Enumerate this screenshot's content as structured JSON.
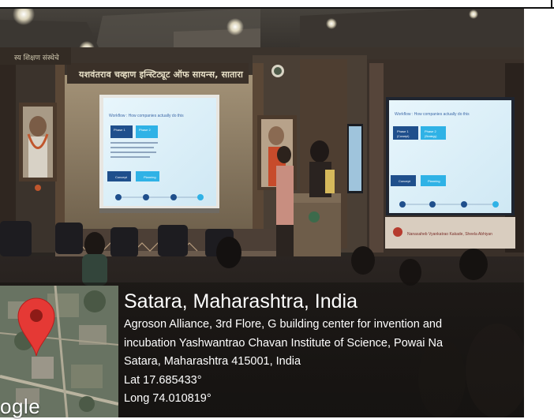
{
  "scene": {
    "banner_main": "यशवंतराव चव्हाण इन्स्टिट्यूट ऑफ सायन्स, सातारा",
    "banner_side": "स्य शिक्षण संस्थेचे",
    "slide": {
      "heading": "Workflow : How companies actually do this",
      "phase1": "Phase 1",
      "phase1_sub": "(Concept)",
      "phase2": "Phase 2",
      "phase2_sub": "(Strategy)",
      "step_concept": "Concept",
      "step_planning": "Planning"
    },
    "banner_right": "Nanasaheb Vyankatrao Kakade, Sheela Abhiyan"
  },
  "geotag": {
    "title": "Satara, Maharashtra, India",
    "address_line1": "Agroson Alliance, 3rd Flore, G building center for invention and",
    "address_line2": "incubation Yashwantrao Chavan Institute of Science, Powai Na",
    "address_line3": "Satara, Maharashtra 415001, India",
    "lat": "Lat 17.685433°",
    "long": "Long 74.010819°",
    "map_brand": "ogle"
  },
  "colors": {
    "pin": "#e53935",
    "overlay_text": "#ffffff",
    "screen_bg": "#dff0f8",
    "screen_blue": "#1f4f8c",
    "screen_cyan": "#2fb2e6"
  },
  "icons": {
    "pin": "map-pin-icon"
  }
}
